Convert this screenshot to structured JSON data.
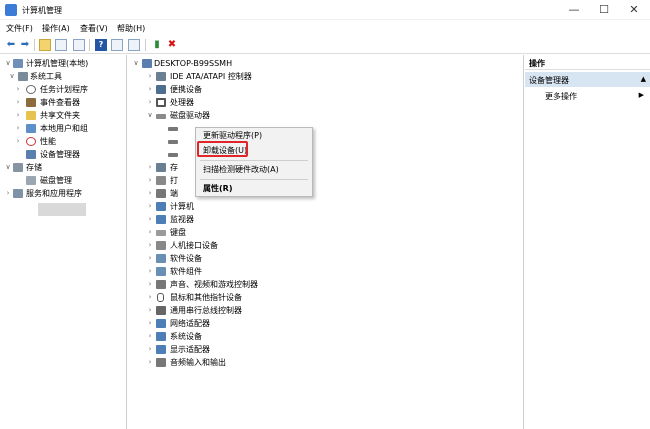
{
  "window": {
    "title": "计算机管理",
    "controls": {
      "minimize": "—",
      "maximize": "☐",
      "close": "✕"
    }
  },
  "menu": [
    "文件(F)",
    "操作(A)",
    "查看(V)",
    "帮助(H)"
  ],
  "toolbar": {
    "icons": [
      "back-arrow-icon",
      "forward-arrow-icon",
      "folder-up-icon",
      "show-hide-tree-icon",
      "properties-icon",
      "help-icon",
      "show-action-pane-icon",
      "monitor-icon",
      "update-driver-icon",
      "uninstall-device-icon"
    ],
    "help_glyph": "?"
  },
  "left_tree": {
    "root": "计算机管理(本地)",
    "system_tools": "系统工具",
    "system_children": [
      "任务计划程序",
      "事件查看器",
      "共享文件夹",
      "本地用户和组",
      "性能",
      "设备管理器"
    ],
    "storage": "存储",
    "storage_children": [
      "磁盘管理"
    ],
    "services": "服务和应用程序",
    "selected": "设备管理器"
  },
  "device_tree": {
    "root": "DESKTOP-B99SSMH",
    "items_top": [
      "IDE ATA/ATAPI 控制器",
      "便携设备",
      "处理器",
      "磁盘驱动器"
    ],
    "partial_items": [
      "存",
      "打",
      "端"
    ],
    "items_bottom": [
      "计算机",
      "监视器",
      "键盘",
      "人机接口设备",
      "软件设备",
      "软件组件",
      "声音、视频和游戏控制器",
      "鼠标和其他指针设备",
      "通用串行总线控制器",
      "网络适配器",
      "系统设备",
      "显示适配器",
      "音频输入和输出"
    ]
  },
  "context_menu": {
    "items": [
      "更新驱动程序(P)",
      "卸载设备(U)",
      "扫描检测硬件改动(A)",
      "属性(R)"
    ],
    "highlighted": "卸载设备(U)"
  },
  "actions_pane": {
    "header": "操作",
    "section": "设备管理器",
    "more": "更多操作",
    "section_caret": "▲",
    "more_caret": "▶"
  },
  "colors": {
    "selection_bg": "#d9d9d9",
    "actions_section_bg": "#d7e4f2",
    "highlight_border": "#e0262b",
    "accent": "#2a6ebb"
  }
}
